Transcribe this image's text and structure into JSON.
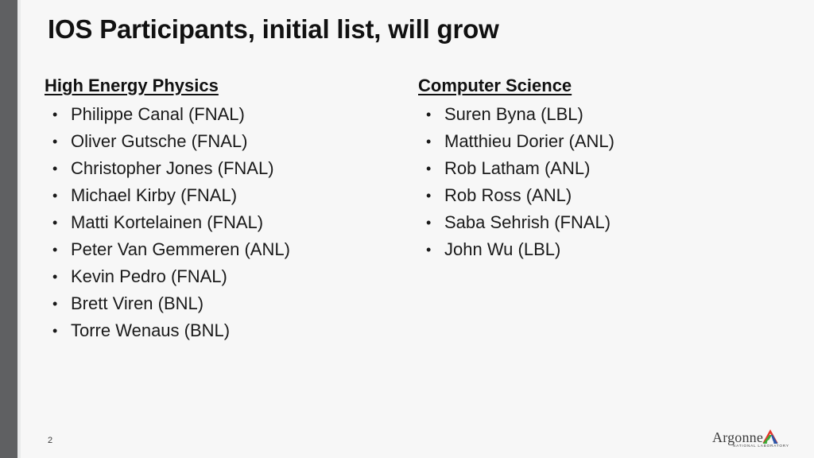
{
  "slide": {
    "title": "IOS Participants, initial list, will grow",
    "page_number": "2",
    "background_color": "#f7f7f7",
    "accent_bar_color": "#5f6062"
  },
  "columns": [
    {
      "heading": "High Energy Physics",
      "items": [
        "Philippe Canal (FNAL)",
        "Oliver Gutsche (FNAL)",
        "Christopher Jones (FNAL)",
        "Michael Kirby (FNAL)",
        "Matti Kortelainen (FNAL)",
        "Peter Van Gemmeren (ANL)",
        "Kevin Pedro (FNAL)",
        "Brett Viren (BNL)",
        "Torre Wenaus (BNL)"
      ]
    },
    {
      "heading": "Computer Science",
      "items": [
        "Suren Byna (LBL)",
        "Matthieu Dorier (ANL)",
        "Rob Latham (ANL)",
        "Rob Ross (ANL)",
        "Saba Sehrish (FNAL)",
        "John Wu (LBL)"
      ]
    }
  ],
  "bullet_glyph": "•",
  "logo": {
    "wordmark": "Argonne",
    "subtitle": "NATIONAL LABORATORY",
    "mark_colors": {
      "top": "#e4352b",
      "left": "#3aa935",
      "right": "#2b56a8"
    }
  }
}
